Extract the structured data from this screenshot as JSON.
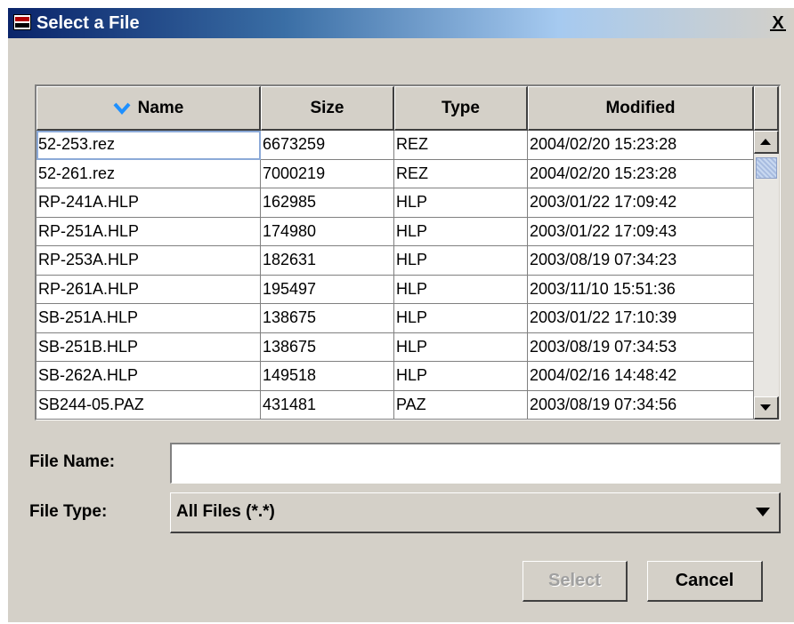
{
  "window": {
    "title": "Select a File",
    "close_label": "X"
  },
  "table": {
    "columns": [
      {
        "label": "Name",
        "sorted": "descending"
      },
      {
        "label": "Size"
      },
      {
        "label": "Type"
      },
      {
        "label": "Modified"
      }
    ],
    "rows": [
      {
        "name": "52-253.rez",
        "size": "6673259",
        "type": "REZ",
        "modified": "2004/02/20   15:23:28"
      },
      {
        "name": "52-261.rez",
        "size": "7000219",
        "type": "REZ",
        "modified": "2004/02/20   15:23:28"
      },
      {
        "name": "RP-241A.HLP",
        "size": "162985",
        "type": "HLP",
        "modified": "2003/01/22   17:09:42"
      },
      {
        "name": "RP-251A.HLP",
        "size": "174980",
        "type": "HLP",
        "modified": "2003/01/22   17:09:43"
      },
      {
        "name": "RP-253A.HLP",
        "size": "182631",
        "type": "HLP",
        "modified": "2003/08/19   07:34:23"
      },
      {
        "name": "RP-261A.HLP",
        "size": "195497",
        "type": "HLP",
        "modified": "2003/11/10   15:51:36"
      },
      {
        "name": "SB-251A.HLP",
        "size": "138675",
        "type": "HLP",
        "modified": "2003/01/22   17:10:39"
      },
      {
        "name": "SB-251B.HLP",
        "size": "138675",
        "type": "HLP",
        "modified": "2003/08/19   07:34:53"
      },
      {
        "name": "SB-262A.HLP",
        "size": "149518",
        "type": "HLP",
        "modified": "2004/02/16   14:48:42"
      },
      {
        "name": "SB244-05.PAZ",
        "size": "431481",
        "type": "PAZ",
        "modified": "2003/08/19   07:34:56"
      }
    ]
  },
  "form": {
    "file_name_label": "File Name:",
    "file_name_value": "",
    "file_type_label": "File Type:",
    "file_type_value": "All Files (*.*)"
  },
  "buttons": {
    "select": "Select",
    "cancel": "Cancel"
  },
  "colors": {
    "title_bar": "#0a246a",
    "dialog_bg": "#d4d0c8",
    "sort_arrow": "#1e90ff"
  }
}
